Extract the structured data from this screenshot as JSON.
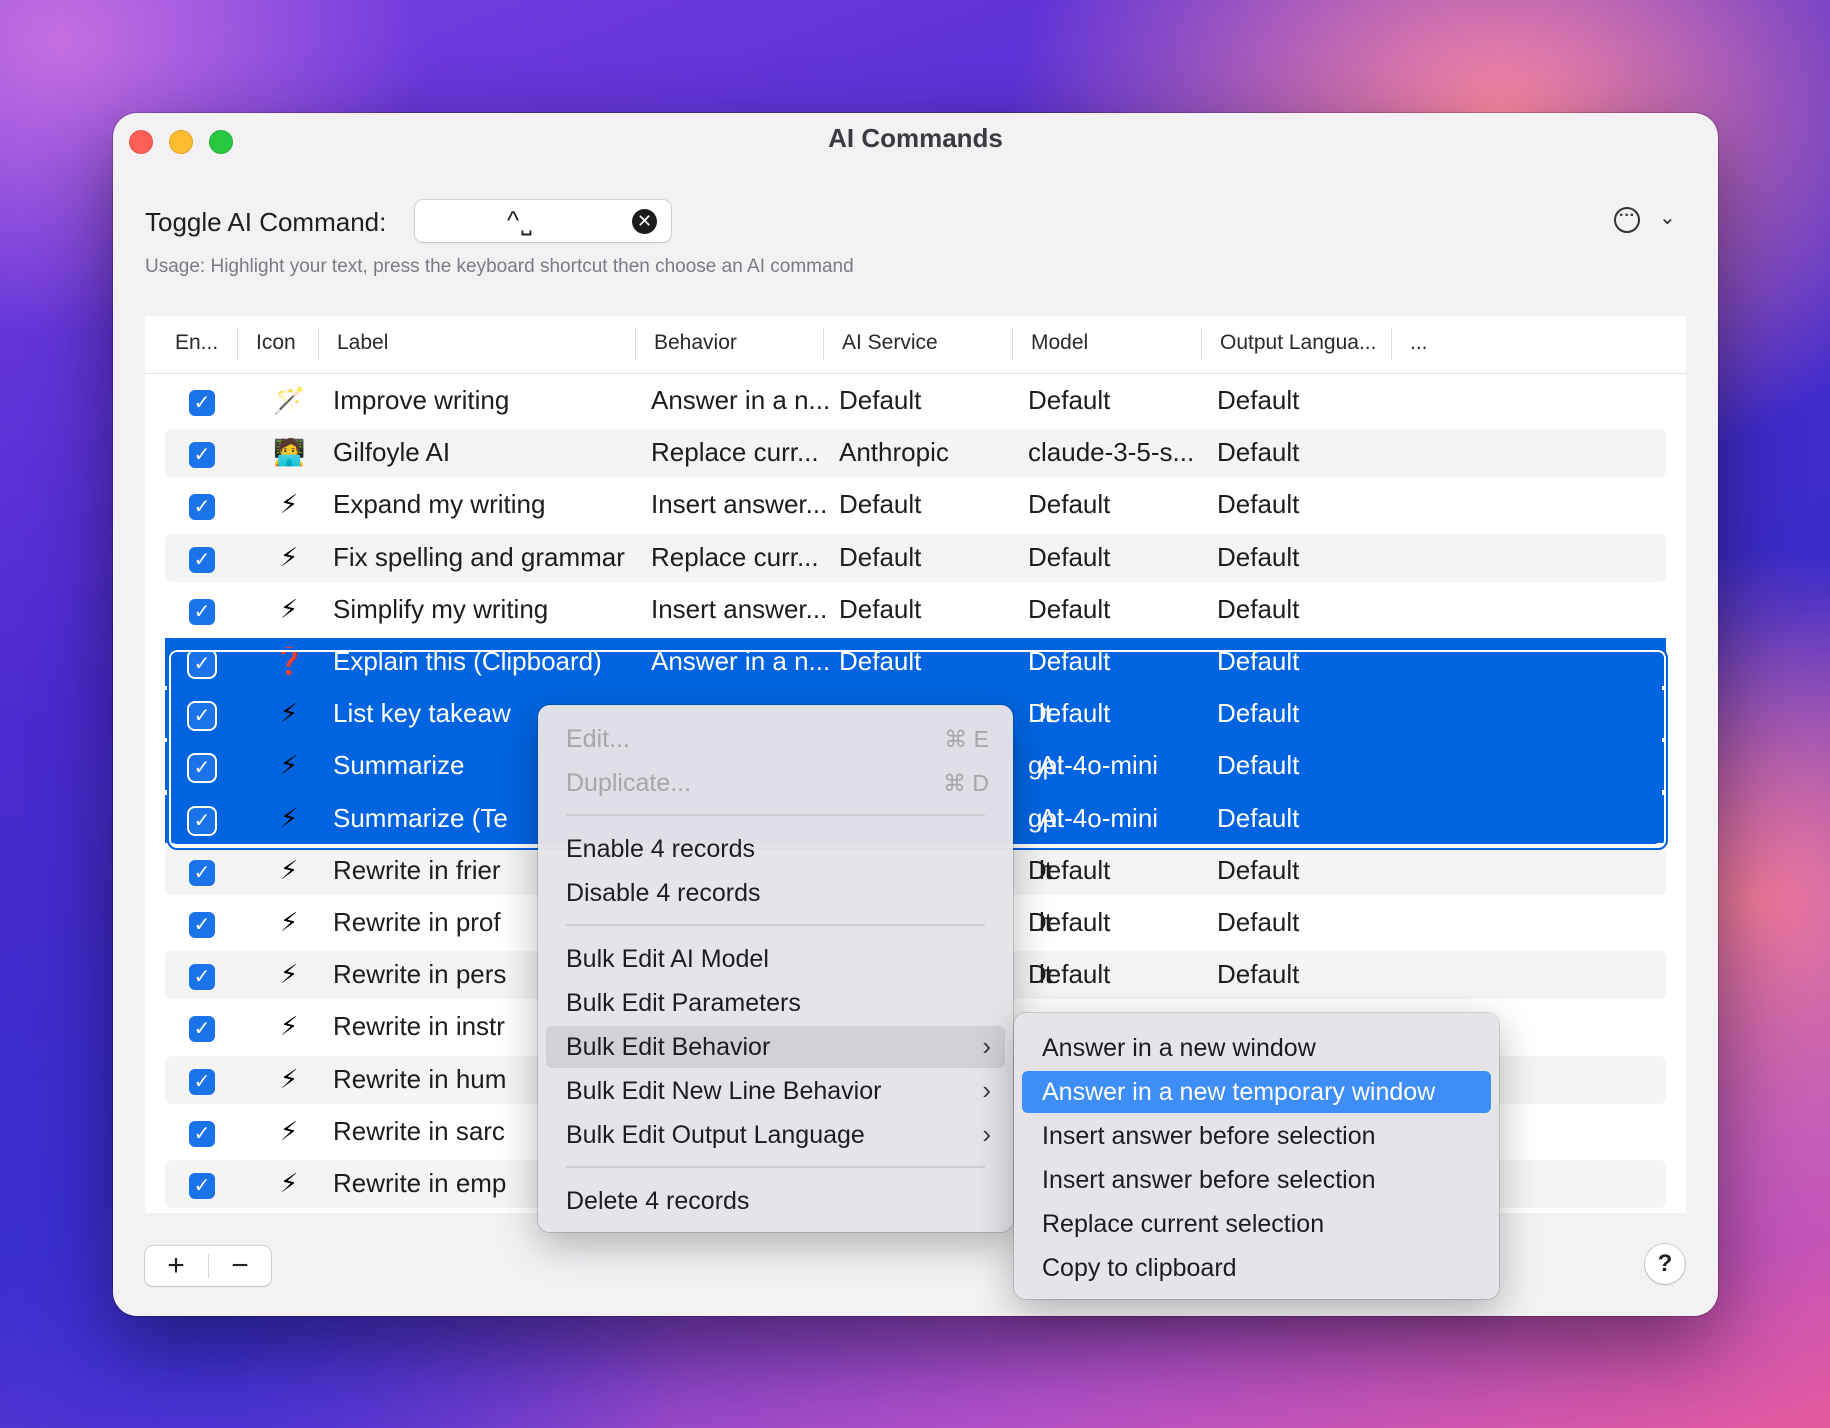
{
  "window": {
    "title": "AI Commands"
  },
  "toggle": {
    "label": "Toggle AI Command:",
    "shortcut_value": "^⎵",
    "clear_glyph": "✕"
  },
  "more_button": {
    "glyph": "···",
    "chevron": "⌄"
  },
  "usage": "Usage: Highlight your text, press the keyboard shortcut then choose an AI command",
  "table": {
    "columns": [
      "En...",
      "Icon",
      "Label",
      "Behavior",
      "AI Service",
      "Model",
      "Output Langua...",
      "..."
    ],
    "rows": [
      {
        "icon": "🪄",
        "label": "Improve writing",
        "behavior": "Answer in a n...",
        "service": "Default",
        "model": "Default",
        "lang": "Default"
      },
      {
        "icon": "🧑‍💻",
        "label": "Gilfoyle AI",
        "behavior": "Replace curr...",
        "service": "Anthropic",
        "model": "claude-3-5-s...",
        "lang": "Default"
      },
      {
        "icon": "⚡",
        "label": "Expand my writing",
        "behavior": "Insert answer...",
        "service": "Default",
        "model": "Default",
        "lang": "Default"
      },
      {
        "icon": "⚡",
        "label": "Fix spelling and grammar",
        "behavior": "Replace curr...",
        "service": "Default",
        "model": "Default",
        "lang": "Default"
      },
      {
        "icon": "⚡",
        "label": "Simplify my writing",
        "behavior": "Insert answer...",
        "service": "Default",
        "model": "Default",
        "lang": "Default"
      },
      {
        "icon": "❓",
        "label": "Explain this (Clipboard)",
        "behavior": "Answer in a n...",
        "service": "Default",
        "model": "Default",
        "lang": "Default"
      },
      {
        "icon": "⚡",
        "label": "List key takeaw",
        "behavior": "",
        "service": "lt",
        "model": "Default",
        "lang": "Default"
      },
      {
        "icon": "⚡",
        "label": "Summarize",
        "behavior": "",
        "service": "AI",
        "model": "gpt-4o-mini",
        "lang": "Default"
      },
      {
        "icon": "⚡",
        "label": "Summarize (Te",
        "behavior": "",
        "service": "AI",
        "model": "gpt-4o-mini",
        "lang": "Default"
      },
      {
        "icon": "⚡",
        "label": "Rewrite in frier",
        "behavior": "",
        "service": "lt",
        "model": "Default",
        "lang": "Default"
      },
      {
        "icon": "⚡",
        "label": "Rewrite in prof",
        "behavior": "",
        "service": "lt",
        "model": "Default",
        "lang": "Default"
      },
      {
        "icon": "⚡",
        "label": "Rewrite in pers",
        "behavior": "",
        "service": "lt",
        "model": "Default",
        "lang": "Default"
      },
      {
        "icon": "⚡",
        "label": "Rewrite in instr",
        "behavior": "",
        "service": "",
        "model": "",
        "lang": ""
      },
      {
        "icon": "⚡",
        "label": "Rewrite in hum",
        "behavior": "",
        "service": "",
        "model": "",
        "lang": ""
      },
      {
        "icon": "⚡",
        "label": "Rewrite in sarc",
        "behavior": "",
        "service": "",
        "model": "",
        "lang": ""
      },
      {
        "icon": "⚡",
        "label": "Rewrite in emp",
        "behavior": "",
        "service": "",
        "model": "",
        "lang": ""
      }
    ]
  },
  "bottom": {
    "add": "+",
    "remove": "−",
    "help": "?"
  },
  "context_menu": {
    "edit": "Edit...",
    "edit_shortcut": "⌘ E",
    "duplicate": "Duplicate...",
    "duplicate_shortcut": "⌘ D",
    "enable": "Enable 4 records",
    "disable": "Disable 4 records",
    "bulk_model": "Bulk Edit AI Model",
    "bulk_params": "Bulk Edit Parameters",
    "bulk_behavior": "Bulk Edit Behavior",
    "bulk_newline": "Bulk Edit New Line Behavior",
    "bulk_lang": "Bulk Edit Output Language",
    "delete": "Delete 4 records",
    "arrow": "›"
  },
  "submenu": {
    "items": [
      "Answer in a new window",
      "Answer in a new temporary window",
      "Insert answer before selection",
      "Insert answer before selection",
      "Replace current selection",
      "Copy to clipboard"
    ]
  },
  "checkmark": "✓"
}
